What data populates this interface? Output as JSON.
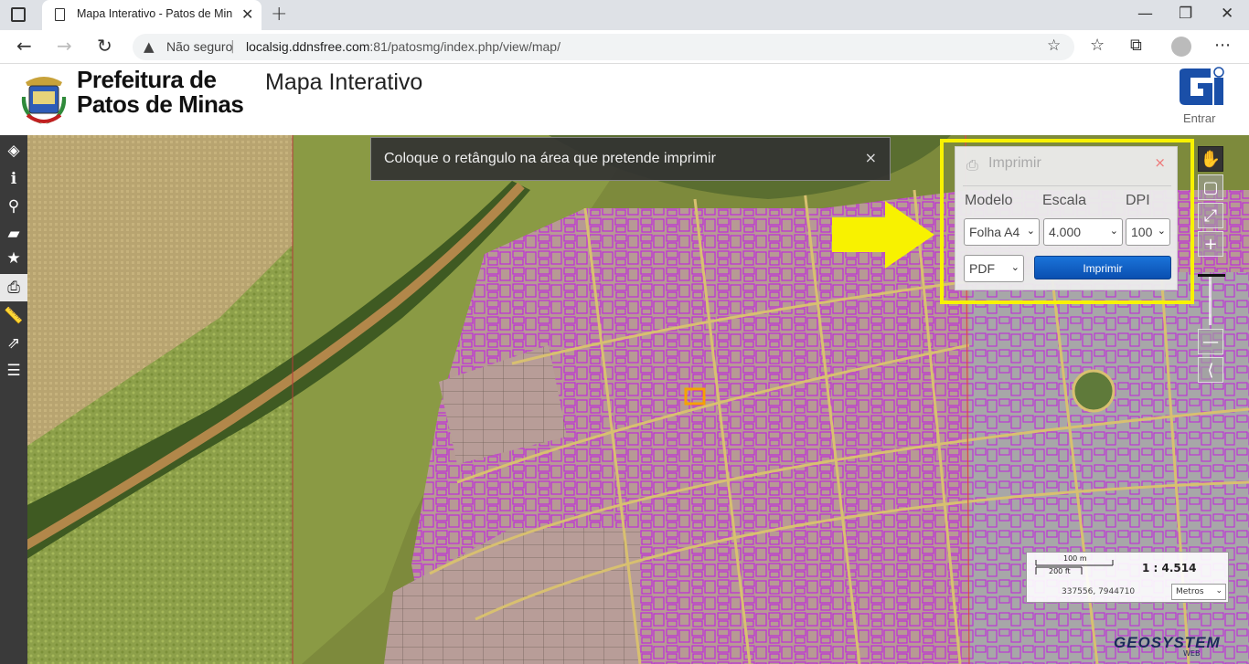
{
  "browser": {
    "tab_title": "Mapa Interativo - Patos de Minas",
    "url_security": "Não seguro",
    "url_host": "localsig.ddnsfree.com",
    "url_rest": ":81/patosmg/index.php/view/map/"
  },
  "header": {
    "org_line1": "Prefeitura de",
    "org_line2": "Patos de Minas",
    "app_title": "Mapa Interativo",
    "login_label": "Entrar"
  },
  "left_toolbar": [
    "layers-icon",
    "info-icon",
    "search-icon",
    "comment-icon",
    "star-icon",
    "print-icon",
    "measure-icon",
    "share-icon",
    "list-icon"
  ],
  "hint": {
    "text": "Coloque o retângulo na área que pretende imprimir",
    "close": "×"
  },
  "print_panel": {
    "title": "Imprimir",
    "close": "×",
    "model_label": "Modelo",
    "scale_label": "Escala",
    "dpi_label": "DPI",
    "model_value": "Folha A4",
    "scale_value": "4.000",
    "dpi_value": "100",
    "format_value": "PDF",
    "print_button": "Imprimir"
  },
  "scale": {
    "bar_top": "100 m",
    "bar_bottom": "200 ft",
    "ratio": "1 : 4.514",
    "coordinates": "337556, 7944710",
    "units": "Metros"
  },
  "branding": {
    "geosystem": "GEOSYSTEM",
    "web": "WEB"
  },
  "colors": {
    "highlight": "#f8f200",
    "print_button": "#1a73d9",
    "parcel_outline": "#c02bd9"
  }
}
